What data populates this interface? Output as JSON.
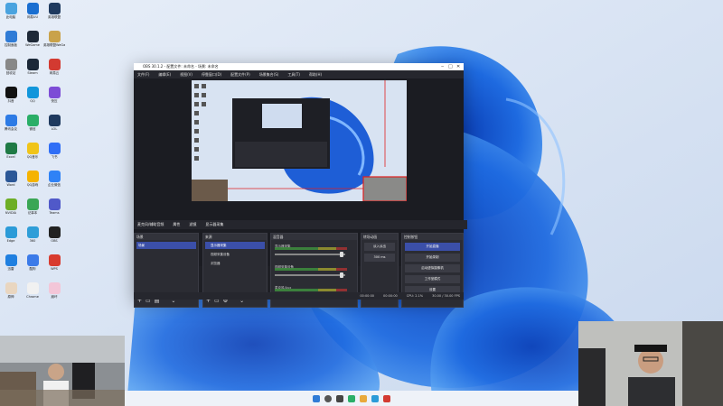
{
  "desktop": {
    "icons": [
      {
        "label": "此电脑",
        "color": "#4aa3df"
      },
      {
        "label": "网易UU",
        "color": "#1a6fd1"
      },
      {
        "label": "英雄联盟",
        "color": "#1f3a5f"
      },
      {
        "label": "控制面板",
        "color": "#2f7bd6"
      },
      {
        "label": "WeGame",
        "color": "#1f2a38"
      },
      {
        "label": "英雄联盟WeGame版",
        "color": "#c9a24a"
      },
      {
        "label": "回收站",
        "color": "#888888"
      },
      {
        "label": "Steam",
        "color": "#1b2838"
      },
      {
        "label": "网易云",
        "color": "#d33a31"
      },
      {
        "label": "抖音",
        "color": "#111111"
      },
      {
        "label": "QQ",
        "color": "#1296db"
      },
      {
        "label": "快压",
        "color": "#7d4cd6"
      },
      {
        "label": "腾讯会议",
        "color": "#2d7be5"
      },
      {
        "label": "微信",
        "color": "#2aae67"
      },
      {
        "label": "LOL",
        "color": "#1f3a5f"
      },
      {
        "label": "Excel",
        "color": "#1f7a45"
      },
      {
        "label": "QQ音乐",
        "color": "#f0c419"
      },
      {
        "label": "飞书",
        "color": "#2f6ef6"
      },
      {
        "label": "Word",
        "color": "#2b5797"
      },
      {
        "label": "QQ游戏",
        "color": "#f5b301"
      },
      {
        "label": "企业微信",
        "color": "#2f82f6"
      },
      {
        "label": "NVIDIA",
        "color": "#6dae26"
      },
      {
        "label": "记事本",
        "color": "#3aa655"
      },
      {
        "label": "Teams",
        "color": "#5059c9"
      },
      {
        "label": "Edge",
        "color": "#2b9bd8"
      },
      {
        "label": "360",
        "color": "#2f9ed8"
      },
      {
        "label": "OBS",
        "color": "#222222"
      },
      {
        "label": "迅雷",
        "color": "#1f7fe0"
      },
      {
        "label": "酷狗",
        "color": "#3b7ae8"
      },
      {
        "label": "WPS",
        "color": "#d83b2f"
      },
      {
        "label": "原神",
        "color": "#e9d6c0"
      },
      {
        "label": "Chrome",
        "color": "#f1f1f1"
      },
      {
        "label": "崩坏",
        "color": "#f3c6d8"
      }
    ]
  },
  "obs": {
    "title": "OBS 30.1.2 - 配置文件: 未命名 - 场景: 未命名",
    "menu": [
      "文件(F)",
      "编辑(E)",
      "视图(V)",
      "停靠窗口(D)",
      "配置文件(P)",
      "场景集合(S)",
      "工具(T)",
      "帮助(H)"
    ],
    "controls_strip": [
      "麦克风/辅助音频",
      "属性",
      "滤镜",
      "显示器采集"
    ],
    "scenes": {
      "header": "场景",
      "items": [
        "场景"
      ]
    },
    "sources": {
      "header": "来源",
      "items": [
        "显示器采集",
        "视频采集设备",
        "浏览器"
      ]
    },
    "mixer": {
      "header": "混音器",
      "tracks": [
        {
          "name": "显示器采集",
          "db": "0.0 dB"
        },
        {
          "name": "视频采集设备",
          "db": "0.0 dB"
        },
        {
          "name": "麦克风/Aux",
          "db": "0.0 dB"
        }
      ]
    },
    "transitions": {
      "header": "转场动画",
      "type": "淡入淡出",
      "duration": "300 ms"
    },
    "controls": {
      "header": "控制按钮",
      "buttons": [
        "开始直播",
        "开始录制",
        "启动虚拟摄像机",
        "工作室模式",
        "设置",
        "退出"
      ]
    },
    "status": [
      "00:00:00",
      "00:00:00",
      "CPU: 2.1%",
      "30.00 / 30.00 FPS"
    ]
  },
  "colors": {
    "accent": "#3b4fa8",
    "wallpaper_blue": "#1f63d8",
    "selection_red": "#e02020"
  }
}
